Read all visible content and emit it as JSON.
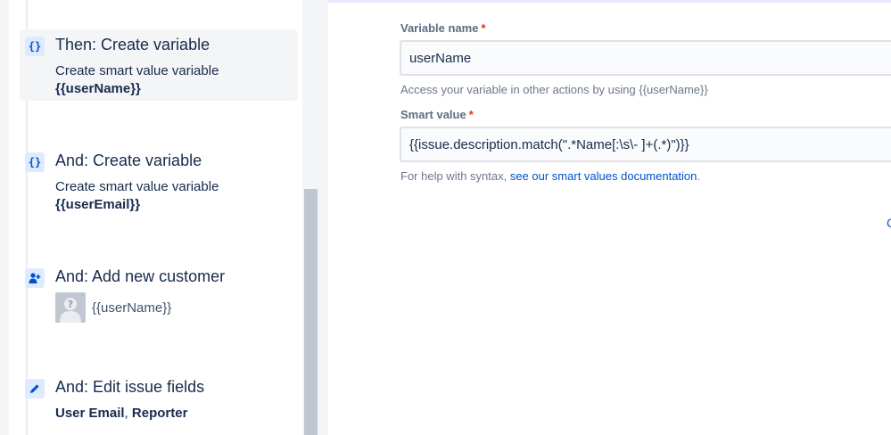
{
  "rule_steps": [
    {
      "title": "Then: Create variable",
      "description": "Create smart value variable",
      "value": "{{userName}}",
      "icon": "braces-icon",
      "selected": true
    },
    {
      "title": "And: Create variable",
      "description": "Create smart value variable",
      "value": "{{userEmail}}",
      "icon": "braces-icon"
    },
    {
      "title": "And: Add new customer",
      "avatar_label": "{{userName}}",
      "icon": "add-person-icon"
    },
    {
      "title": "And: Edit issue fields",
      "fields": [
        "User Email",
        "Reporter"
      ],
      "separator": ", ",
      "icon": "pencil-icon"
    }
  ],
  "form": {
    "variable_name": {
      "label": "Variable name",
      "required_mark": "*",
      "value": "userName",
      "help": "Access your variable in other actions by using {{userName}}"
    },
    "smart_value": {
      "label": "Smart value",
      "required_mark": "*",
      "value": "{{issue.description.match(\".*Name[:\\s\\- ]+(.*)\")}}",
      "help_prefix": "For help with syntax, ",
      "help_link": "see our smart values documentation",
      "help_suffix": "."
    },
    "edge_link": "C"
  },
  "colors": {
    "accent": "#0052cc",
    "icon_bg": "#deebff",
    "required": "#de350b",
    "selected_bg": "#f4f5f7"
  }
}
